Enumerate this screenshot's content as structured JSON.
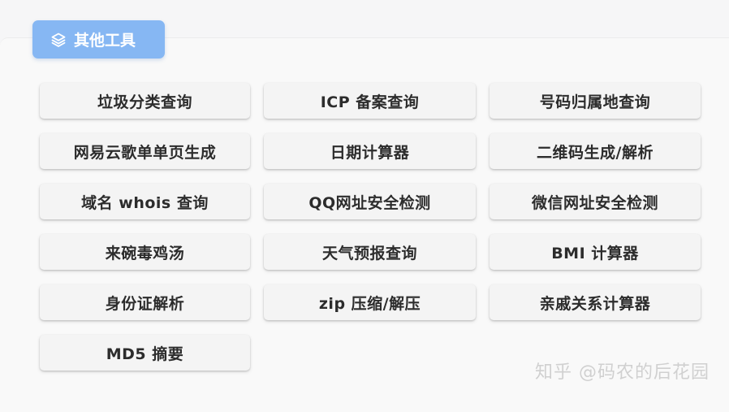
{
  "header": {
    "title": "其他工具",
    "icon": "layers-icon"
  },
  "tools": [
    "垃圾分类查询",
    "ICP 备案查询",
    "号码归属地查询",
    "网易云歌单单页生成",
    "日期计算器",
    "二维码生成/解析",
    "域名 whois 查询",
    "QQ网址安全检测",
    "微信网址安全检测",
    "来碗毒鸡汤",
    "天气预报查询",
    "BMI 计算器",
    "身份证解析",
    "zip 压缩/解压",
    "亲戚关系计算器",
    "MD5 摘要"
  ],
  "watermark": "知乎 @码农的后花园",
  "colors": {
    "accent": "#86b7f3",
    "button_bg": "#f4f4f4",
    "text": "#2c2c2c"
  }
}
